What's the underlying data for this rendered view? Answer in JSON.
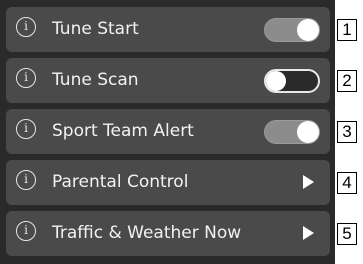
{
  "rows": [
    {
      "label": "Tune Start",
      "control": "toggle",
      "state": "on",
      "callout": "1"
    },
    {
      "label": "Tune Scan",
      "control": "toggle",
      "state": "off",
      "callout": "2"
    },
    {
      "label": "Sport Team Alert",
      "control": "toggle",
      "state": "on",
      "callout": "3"
    },
    {
      "label": "Parental Control",
      "control": "arrow",
      "callout": "4"
    },
    {
      "label": "Traffic & Weather Now",
      "control": "arrow",
      "callout": "5"
    }
  ],
  "info_icon_glyph": "i",
  "colors": {
    "panel": "#2a2a2a",
    "row": "#4a4a4a",
    "toggle_on": "#8c8c8c",
    "text": "#f2f2f2"
  }
}
